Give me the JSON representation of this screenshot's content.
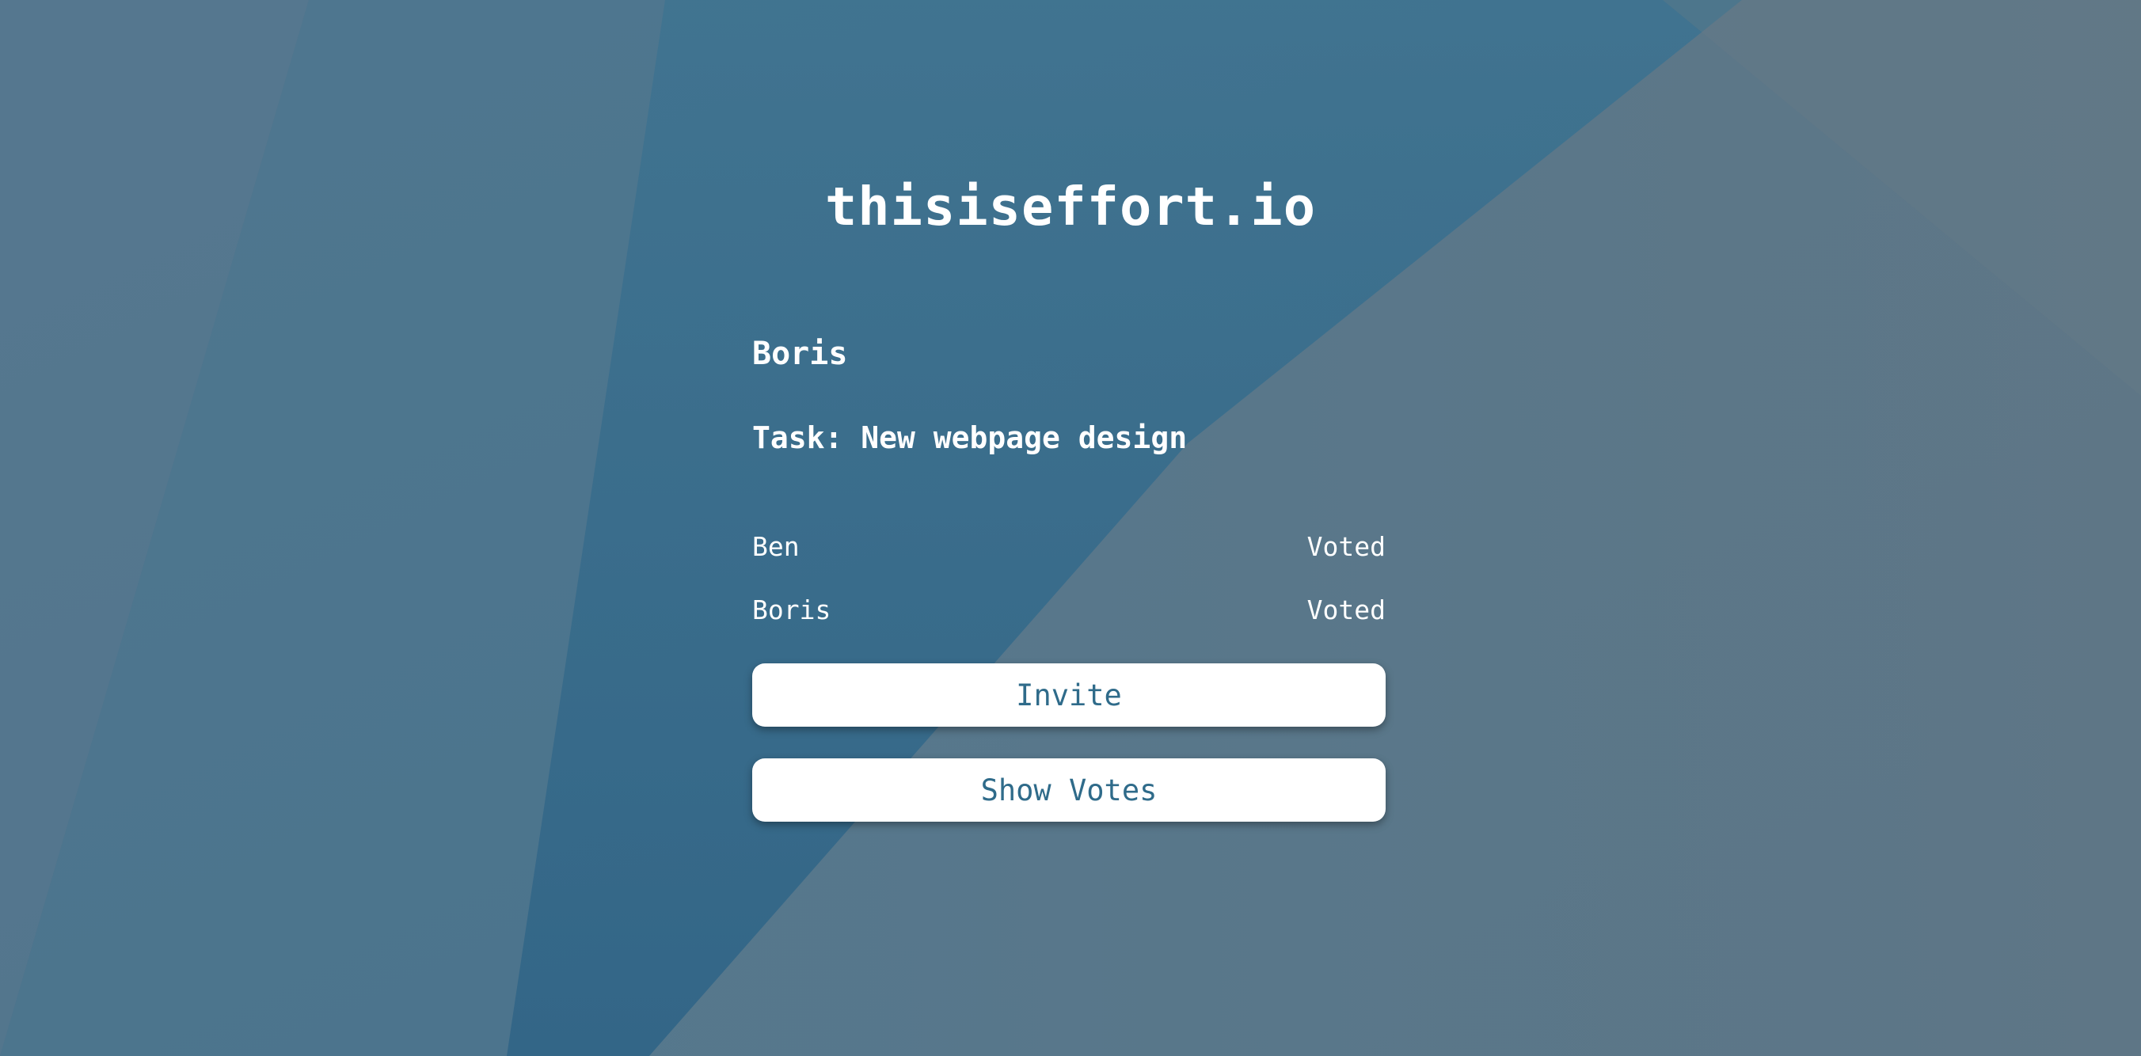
{
  "app": {
    "logo_text": "thisiseffort.io"
  },
  "session": {
    "current_user": "Boris",
    "task_label": "Task: New webpage design"
  },
  "participants": [
    {
      "name": "Ben",
      "status": "Voted"
    },
    {
      "name": "Boris",
      "status": "Voted"
    }
  ],
  "actions": {
    "invite_label": "Invite",
    "show_votes_label": "Show Votes"
  },
  "theme": {
    "background": "#4f7289",
    "accent_dark": "#2c6485",
    "button_text": "#2f6b8a",
    "button_bg": "#ffffff"
  }
}
